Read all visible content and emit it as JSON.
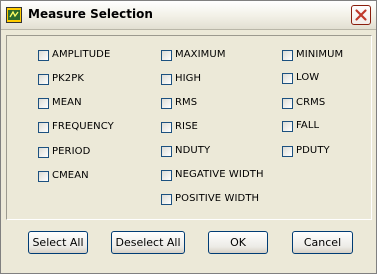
{
  "window": {
    "title": "Measure Selection"
  },
  "measurements": {
    "col1": [
      "AMPLITUDE",
      "PK2PK",
      "MEAN",
      "FREQUENCY",
      "PERIOD",
      "CMEAN"
    ],
    "col2": [
      "MAXIMUM",
      "HIGH",
      "RMS",
      "RISE",
      "NDUTY",
      "NEGATIVE WIDTH",
      "POSITIVE WIDTH"
    ],
    "col3": [
      "MINIMUM",
      "LOW",
      "CRMS",
      "FALL",
      "PDUTY"
    ]
  },
  "buttons": {
    "select_all": "Select All",
    "deselect_all": "Deselect All",
    "ok": "OK",
    "cancel": "Cancel"
  },
  "icons": {
    "app": "labview-vi-icon",
    "close": "close-icon"
  },
  "colors": {
    "close_x": "#c0392b",
    "checkbox_border": "#1c5180"
  }
}
